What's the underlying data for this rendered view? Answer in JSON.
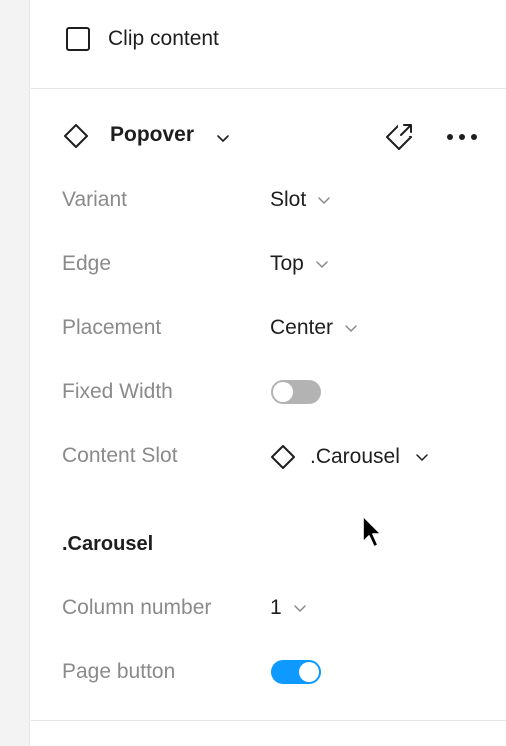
{
  "clip_content": {
    "label": "Clip content",
    "checked": false
  },
  "component": {
    "name": "Popover",
    "icon": "component-diamond-icon",
    "actions": [
      "detach-instance-icon",
      "more-options-icon"
    ]
  },
  "properties": [
    {
      "key": "variant",
      "label": "Variant",
      "value": "Slot",
      "type": "dropdown"
    },
    {
      "key": "edge",
      "label": "Edge",
      "value": "Top",
      "type": "dropdown"
    },
    {
      "key": "placement",
      "label": "Placement",
      "value": "Center",
      "type": "dropdown"
    },
    {
      "key": "fixed_width",
      "label": "Fixed Width",
      "type": "toggle",
      "on": false
    },
    {
      "key": "content_slot",
      "label": "Content Slot",
      "value": ".Carousel",
      "type": "instance-swap"
    }
  ],
  "nested": {
    "title": ".Carousel",
    "properties": [
      {
        "key": "column_number",
        "label": "Column number",
        "value": "1",
        "type": "dropdown"
      },
      {
        "key": "page_button",
        "label": "Page button",
        "type": "toggle",
        "on": true
      }
    ]
  },
  "colors": {
    "toggle_on": "#0d99ff",
    "toggle_off": "#b3b3b3",
    "label": "#8a8a8a",
    "text": "#1e1e1e",
    "divider": "#e6e6e6"
  }
}
